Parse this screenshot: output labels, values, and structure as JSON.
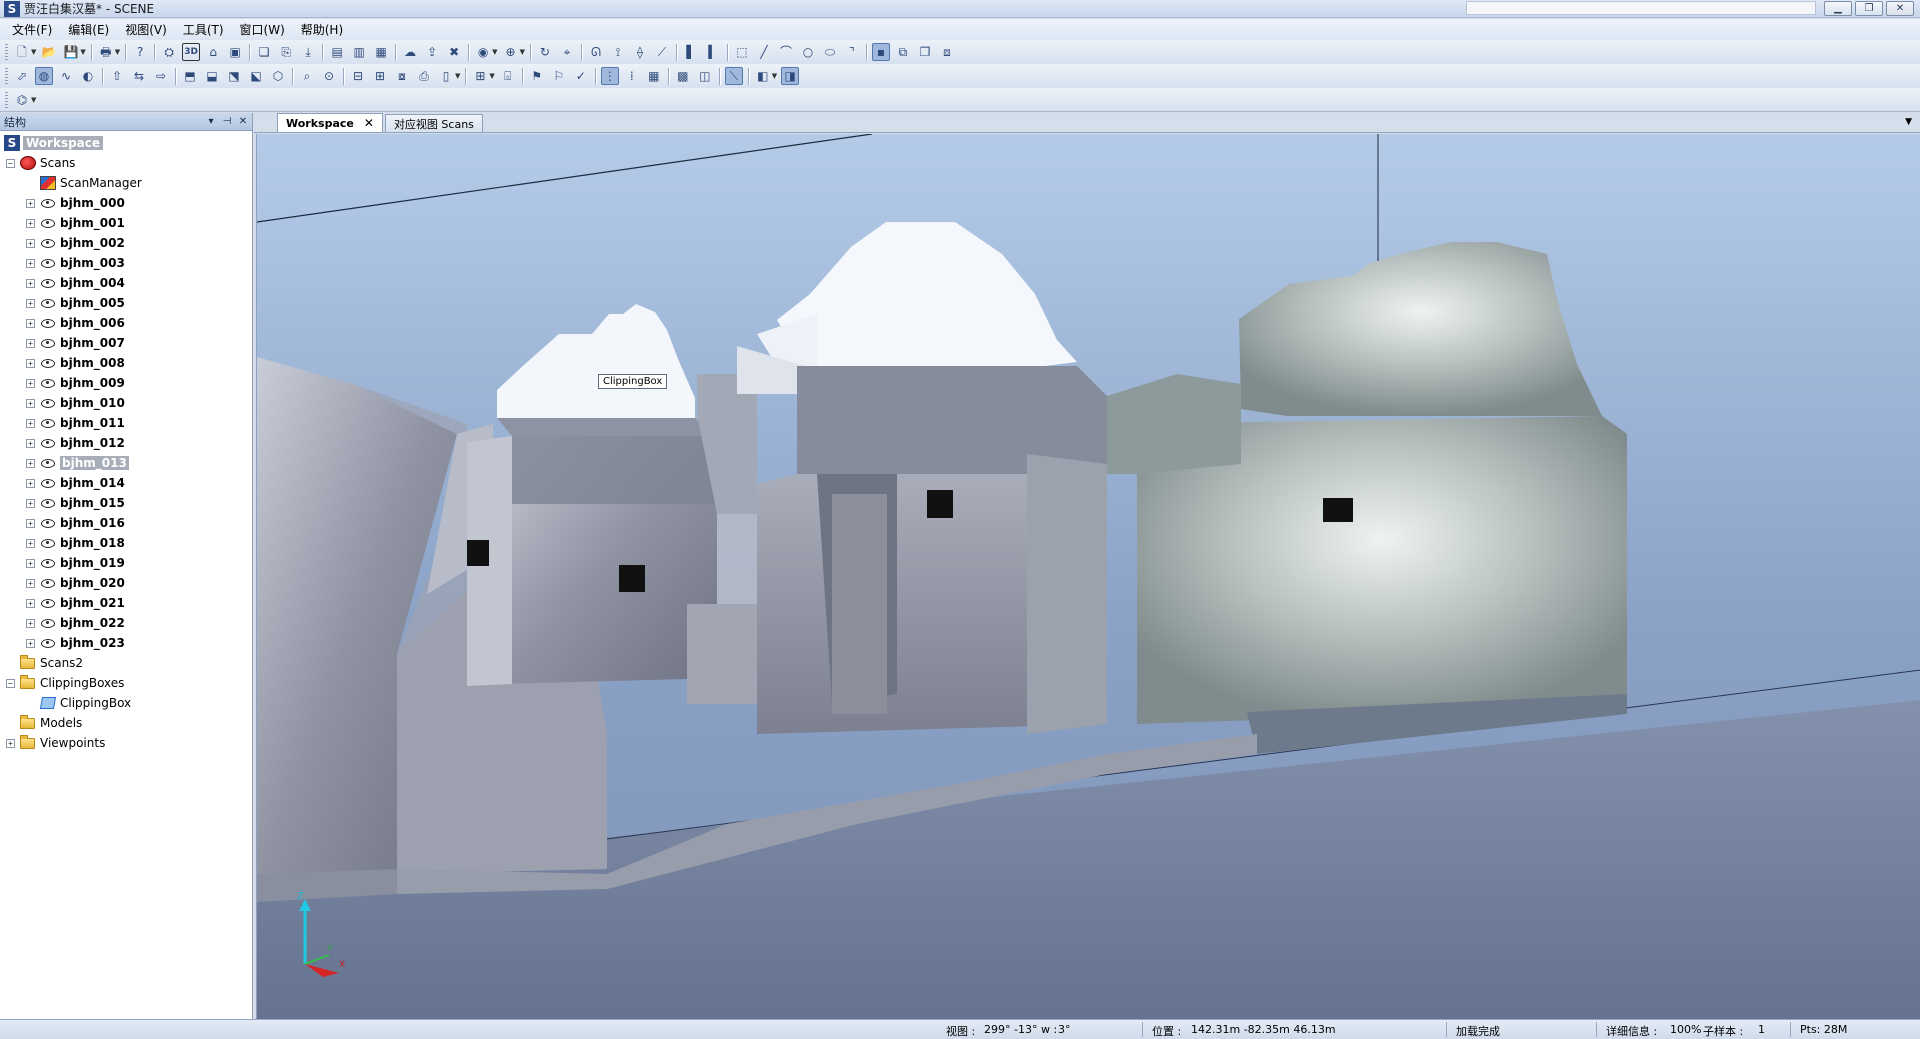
{
  "window": {
    "title": "贾汪白集汉墓* - SCENE",
    "logo": "S",
    "controls": [
      "minimize-icon",
      "restore-icon",
      "close-icon"
    ]
  },
  "menu": [
    "文件(F)",
    "编辑(E)",
    "视图(V)",
    "工具(T)",
    "窗口(W)",
    "帮助(H)"
  ],
  "panel": {
    "title": "结构",
    "workspace_label": "Workspace",
    "tree": [
      {
        "label": "Scans",
        "icon": "scans-icon",
        "level": 1,
        "expander": "−"
      },
      {
        "label": "ScanManager",
        "icon": "scan-manager-icon",
        "level": 2,
        "expander": ""
      },
      {
        "label": "bjhm_000",
        "icon": "scan-icon",
        "level": 2,
        "expander": "+",
        "bold": true
      },
      {
        "label": "bjhm_001",
        "icon": "scan-icon",
        "level": 2,
        "expander": "+",
        "bold": true
      },
      {
        "label": "bjhm_002",
        "icon": "scan-icon",
        "level": 2,
        "expander": "+",
        "bold": true
      },
      {
        "label": "bjhm_003",
        "icon": "scan-icon",
        "level": 2,
        "expander": "+",
        "bold": true
      },
      {
        "label": "bjhm_004",
        "icon": "scan-icon",
        "level": 2,
        "expander": "+",
        "bold": true
      },
      {
        "label": "bjhm_005",
        "icon": "scan-icon",
        "level": 2,
        "expander": "+",
        "bold": true
      },
      {
        "label": "bjhm_006",
        "icon": "scan-icon",
        "level": 2,
        "expander": "+",
        "bold": true
      },
      {
        "label": "bjhm_007",
        "icon": "scan-icon",
        "level": 2,
        "expander": "+",
        "bold": true
      },
      {
        "label": "bjhm_008",
        "icon": "scan-icon",
        "level": 2,
        "expander": "+",
        "bold": true
      },
      {
        "label": "bjhm_009",
        "icon": "scan-icon",
        "level": 2,
        "expander": "+",
        "bold": true
      },
      {
        "label": "bjhm_010",
        "icon": "scan-icon",
        "level": 2,
        "expander": "+",
        "bold": true
      },
      {
        "label": "bjhm_011",
        "icon": "scan-icon",
        "level": 2,
        "expander": "+",
        "bold": true
      },
      {
        "label": "bjhm_012",
        "icon": "scan-icon",
        "level": 2,
        "expander": "+",
        "bold": true
      },
      {
        "label": "bjhm_013",
        "icon": "scan-icon",
        "level": 2,
        "expander": "+",
        "bold": true,
        "selected": true
      },
      {
        "label": "bjhm_014",
        "icon": "scan-icon",
        "level": 2,
        "expander": "+",
        "bold": true
      },
      {
        "label": "bjhm_015",
        "icon": "scan-icon",
        "level": 2,
        "expander": "+",
        "bold": true
      },
      {
        "label": "bjhm_016",
        "icon": "scan-icon",
        "level": 2,
        "expander": "+",
        "bold": true
      },
      {
        "label": "bjhm_018",
        "icon": "scan-icon",
        "level": 2,
        "expander": "+",
        "bold": true
      },
      {
        "label": "bjhm_019",
        "icon": "scan-icon",
        "level": 2,
        "expander": "+",
        "bold": true
      },
      {
        "label": "bjhm_020",
        "icon": "scan-icon",
        "level": 2,
        "expander": "+",
        "bold": true
      },
      {
        "label": "bjhm_021",
        "icon": "scan-icon",
        "level": 2,
        "expander": "+",
        "bold": true
      },
      {
        "label": "bjhm_022",
        "icon": "scan-icon",
        "level": 2,
        "expander": "+",
        "bold": true
      },
      {
        "label": "bjhm_023",
        "icon": "scan-icon",
        "level": 2,
        "expander": "+",
        "bold": true
      },
      {
        "label": "Scans2",
        "icon": "folder-icon",
        "level": 1,
        "expander": ""
      },
      {
        "label": "ClippingBoxes",
        "icon": "folder-icon",
        "level": 1,
        "expander": "−"
      },
      {
        "label": "ClippingBox",
        "icon": "clipping-box-icon",
        "level": 2,
        "expander": ""
      },
      {
        "label": "Models",
        "icon": "folder-icon",
        "level": 1,
        "expander": ""
      },
      {
        "label": "Viewpoints",
        "icon": "folder-icon",
        "level": 1,
        "expander": "+"
      }
    ]
  },
  "tabs": [
    {
      "label": "Workspace",
      "active": true,
      "closable": true
    },
    {
      "label": "对应视图 Scans",
      "active": false,
      "closable": false
    }
  ],
  "viewport": {
    "clipping_box_label": "ClippingBox",
    "axes": {
      "z": "Z",
      "y": "Y",
      "x": "X"
    }
  },
  "status": {
    "view_label": "视图 :",
    "view_value": "299° -13° w :",
    "view_extra": "3°",
    "position_label": "位置 :",
    "position_value": "142.31m -82.35m 46.13m",
    "load_status": "加载完成",
    "detail_label": "详细信息 :",
    "detail_value": "100%",
    "subsample_label": "子样本 :",
    "subsample_value": "1",
    "points_label": "Pts: 28M"
  },
  "colors": {
    "accent": "#264889",
    "selection": "#a8adb8",
    "viewport_sky": "#a9c1e3",
    "ground": "#6f7d99"
  }
}
